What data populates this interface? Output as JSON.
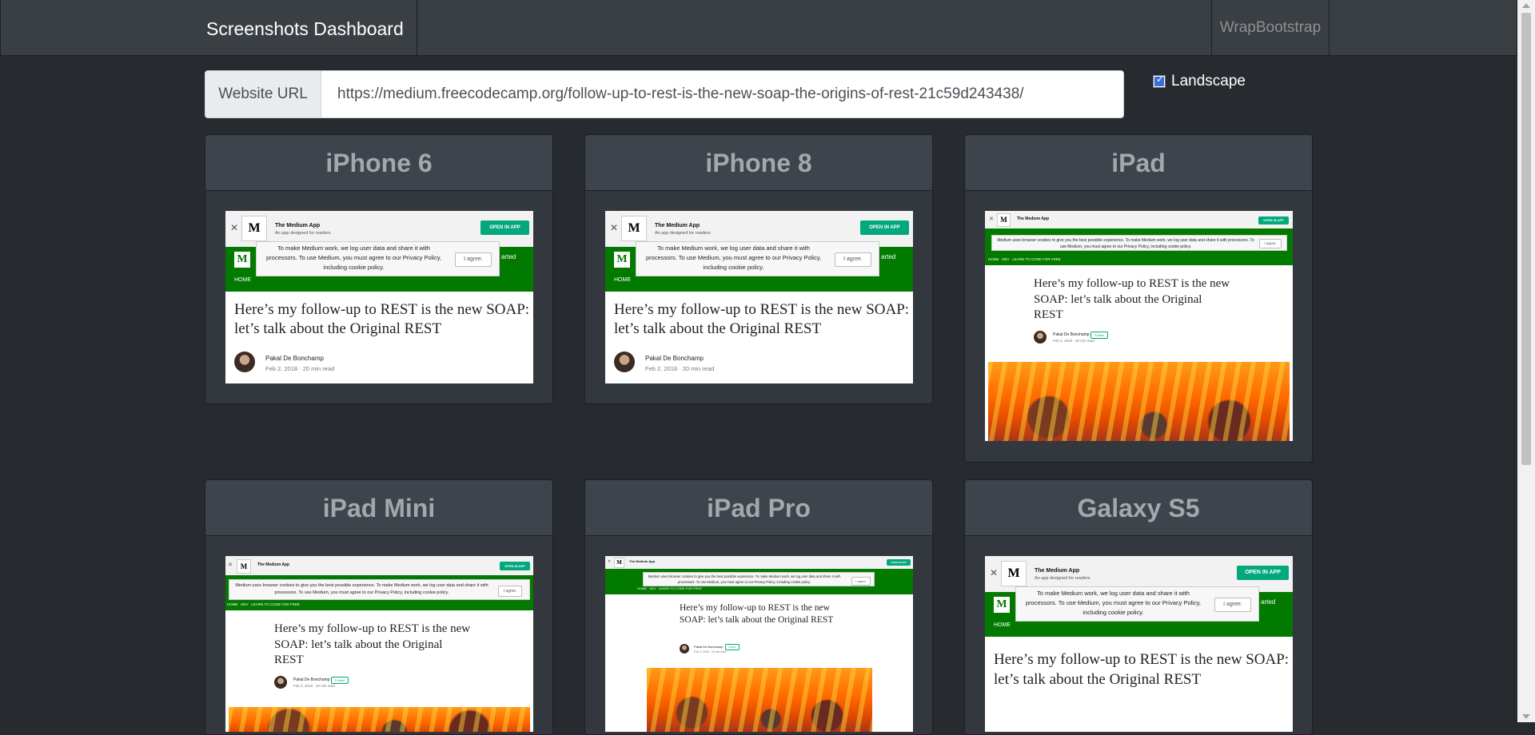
{
  "navbar": {
    "brand": "Screenshots Dashboard",
    "right_link": "WrapBootstrap"
  },
  "form": {
    "url_label": "Website URL",
    "url_value": "https://medium.freecodecamp.org/follow-up-to-rest-is-the-new-soap-the-origins-of-rest-21c59d243438/",
    "landscape_label": "Landscape",
    "landscape_checked": true
  },
  "article": {
    "banner_title": "The Medium App",
    "banner_subtitle": "An app designed for readers.",
    "open_in_app": "OPEN IN APP",
    "cookie_text_short": "To make Medium work, we log user data and share it with processors. To use Medium, you must agree to our Privacy Policy, including cookie policy.",
    "cookie_text_long": "Medium uses browser cookies to give you the best possible experience. To make Medium work, we log user data and share it with processors. To use Medium, you must agree to our Privacy Policy, including cookie policy.",
    "agree": "I agree.",
    "home": "HOME",
    "started": "arted",
    "nav_small": "HOME   DEV   LEARN TO CODE FOR FREE",
    "logo_letter": "M",
    "title": "Here’s my follow-up to REST is the new SOAP: let’s talk about the Original REST",
    "author": "Pakal De Bonchamp",
    "meta": "Feb 2, 2018 · 20 min read",
    "follow": "Follow"
  },
  "devices": [
    {
      "name": "iPhone 6"
    },
    {
      "name": "iPhone 8"
    },
    {
      "name": "iPad"
    },
    {
      "name": "iPad Mini"
    },
    {
      "name": "iPad Pro"
    },
    {
      "name": "Galaxy S5"
    }
  ]
}
